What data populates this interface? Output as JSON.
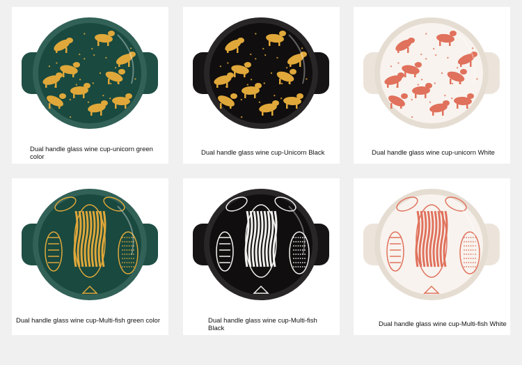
{
  "products": [
    {
      "caption": "Dual handle glass wine cup-unicorn green color",
      "body_color": "#1f4f45",
      "pattern_color": "#e0a83a",
      "pattern": "unicorn"
    },
    {
      "caption": "Dual handle glass wine cup-Unicorn Black",
      "body_color": "#161414",
      "pattern_color": "#e0a83a",
      "pattern": "unicorn"
    },
    {
      "caption": "Dual handle glass wine cup-unicorn White",
      "body_color": "#f3ece4",
      "pattern_color": "#e0715c",
      "pattern": "unicorn"
    },
    {
      "caption": "Dual handle glass wine cup-Multi-fish green color",
      "body_color": "#1f4f45",
      "pattern_color": "#e0a83a",
      "pattern": "fish"
    },
    {
      "caption": "Dual handle glass wine cup-Multi-fish Black",
      "body_color": "#161414",
      "pattern_color": "#f2f2f0",
      "pattern": "fish"
    },
    {
      "caption": "Dual handle glass wine cup-Multi-fish White",
      "body_color": "#f3ece4",
      "pattern_color": "#e0715c",
      "pattern": "fish"
    }
  ]
}
